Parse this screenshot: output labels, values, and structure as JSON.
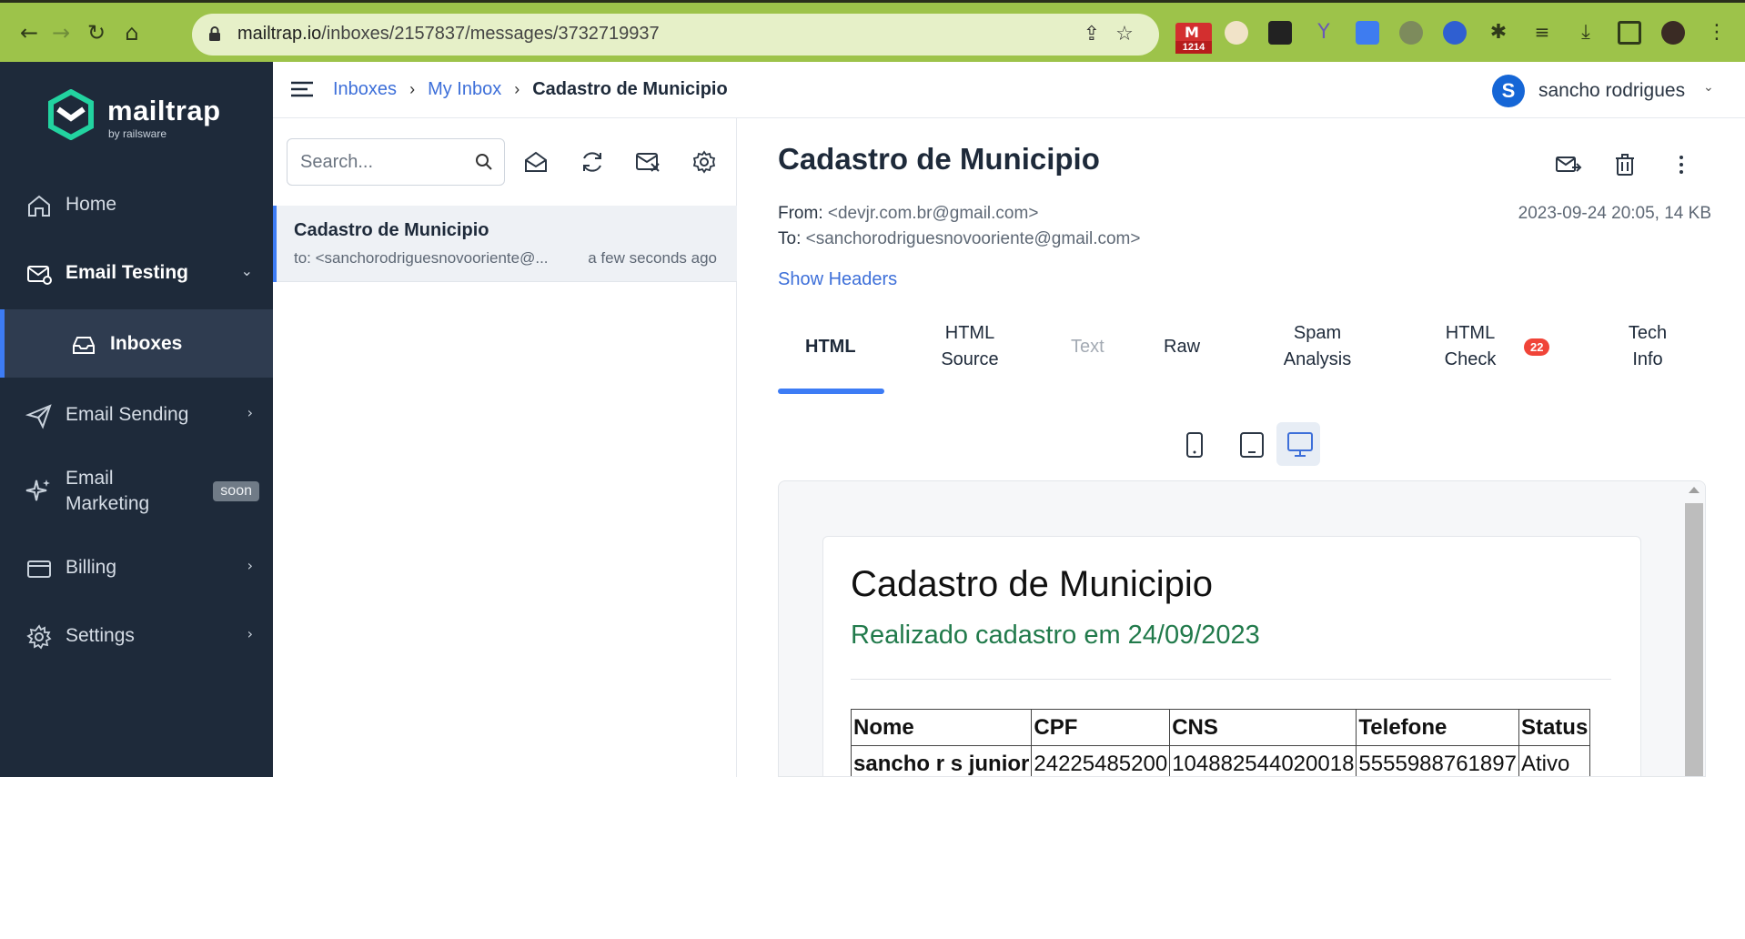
{
  "browser": {
    "url_host": "mailtrap.io",
    "url_path": "/inboxes/2157837/messages/3732719937",
    "mail_ext_count": "1214",
    "mail_ext_letter": "M"
  },
  "sidebar": {
    "brand": "mailtrap",
    "brand_sub": "by railsware",
    "items": [
      {
        "label": "Home"
      },
      {
        "label": "Email Testing"
      },
      {
        "label": "Inboxes"
      },
      {
        "label": "Email Sending"
      },
      {
        "label": "Email Marketing",
        "badge": "soon"
      },
      {
        "label": "Billing"
      },
      {
        "label": "Settings"
      }
    ]
  },
  "header": {
    "breadcrumb": [
      "Inboxes",
      "My Inbox",
      "Cadastro de Municipio"
    ],
    "user_initial": "S",
    "user_name": "sancho rodrigues"
  },
  "list": {
    "search_placeholder": "Search...",
    "messages": [
      {
        "subject": "Cadastro de Municipio",
        "to": "to: <sanchorodriguesnovooriente@...",
        "time": "a few seconds ago"
      }
    ]
  },
  "message": {
    "subject": "Cadastro de Municipio",
    "from_label": "From:",
    "from": "<devjr.com.br@gmail.com>",
    "to_label": "To:",
    "to": "<sanchorodriguesnovooriente@gmail.com>",
    "date_size": "2023-09-24 20:05, 14 KB",
    "show_headers": "Show Headers",
    "tabs": [
      {
        "line1": "HTML",
        "line2": ""
      },
      {
        "line1": "HTML",
        "line2": "Source"
      },
      {
        "line1": "Text",
        "line2": ""
      },
      {
        "line1": "Raw",
        "line2": ""
      },
      {
        "line1": "Spam",
        "line2": "Analysis"
      },
      {
        "line1": "HTML",
        "line2": "Check"
      },
      {
        "line1": "Tech",
        "line2": "Info"
      }
    ],
    "html_check_badge": "22"
  },
  "email_body": {
    "heading": "Cadastro de Municipio",
    "subheading": "Realizado cadastro em 24/09/2023",
    "table_headers": [
      "Nome",
      "CPF",
      "CNS",
      "Telefone",
      "Status"
    ],
    "table_rows": [
      [
        "sancho r s junior",
        "24225485200",
        "104882544020018",
        "5555988761897",
        "Ativo"
      ]
    ]
  },
  "colors": {
    "sidebar_bg": "#1e2a3a",
    "accent": "#3d7cf5",
    "link": "#3d6fd9",
    "subheading_green": "#217a4b",
    "chrome_green": "#9dc34a"
  }
}
